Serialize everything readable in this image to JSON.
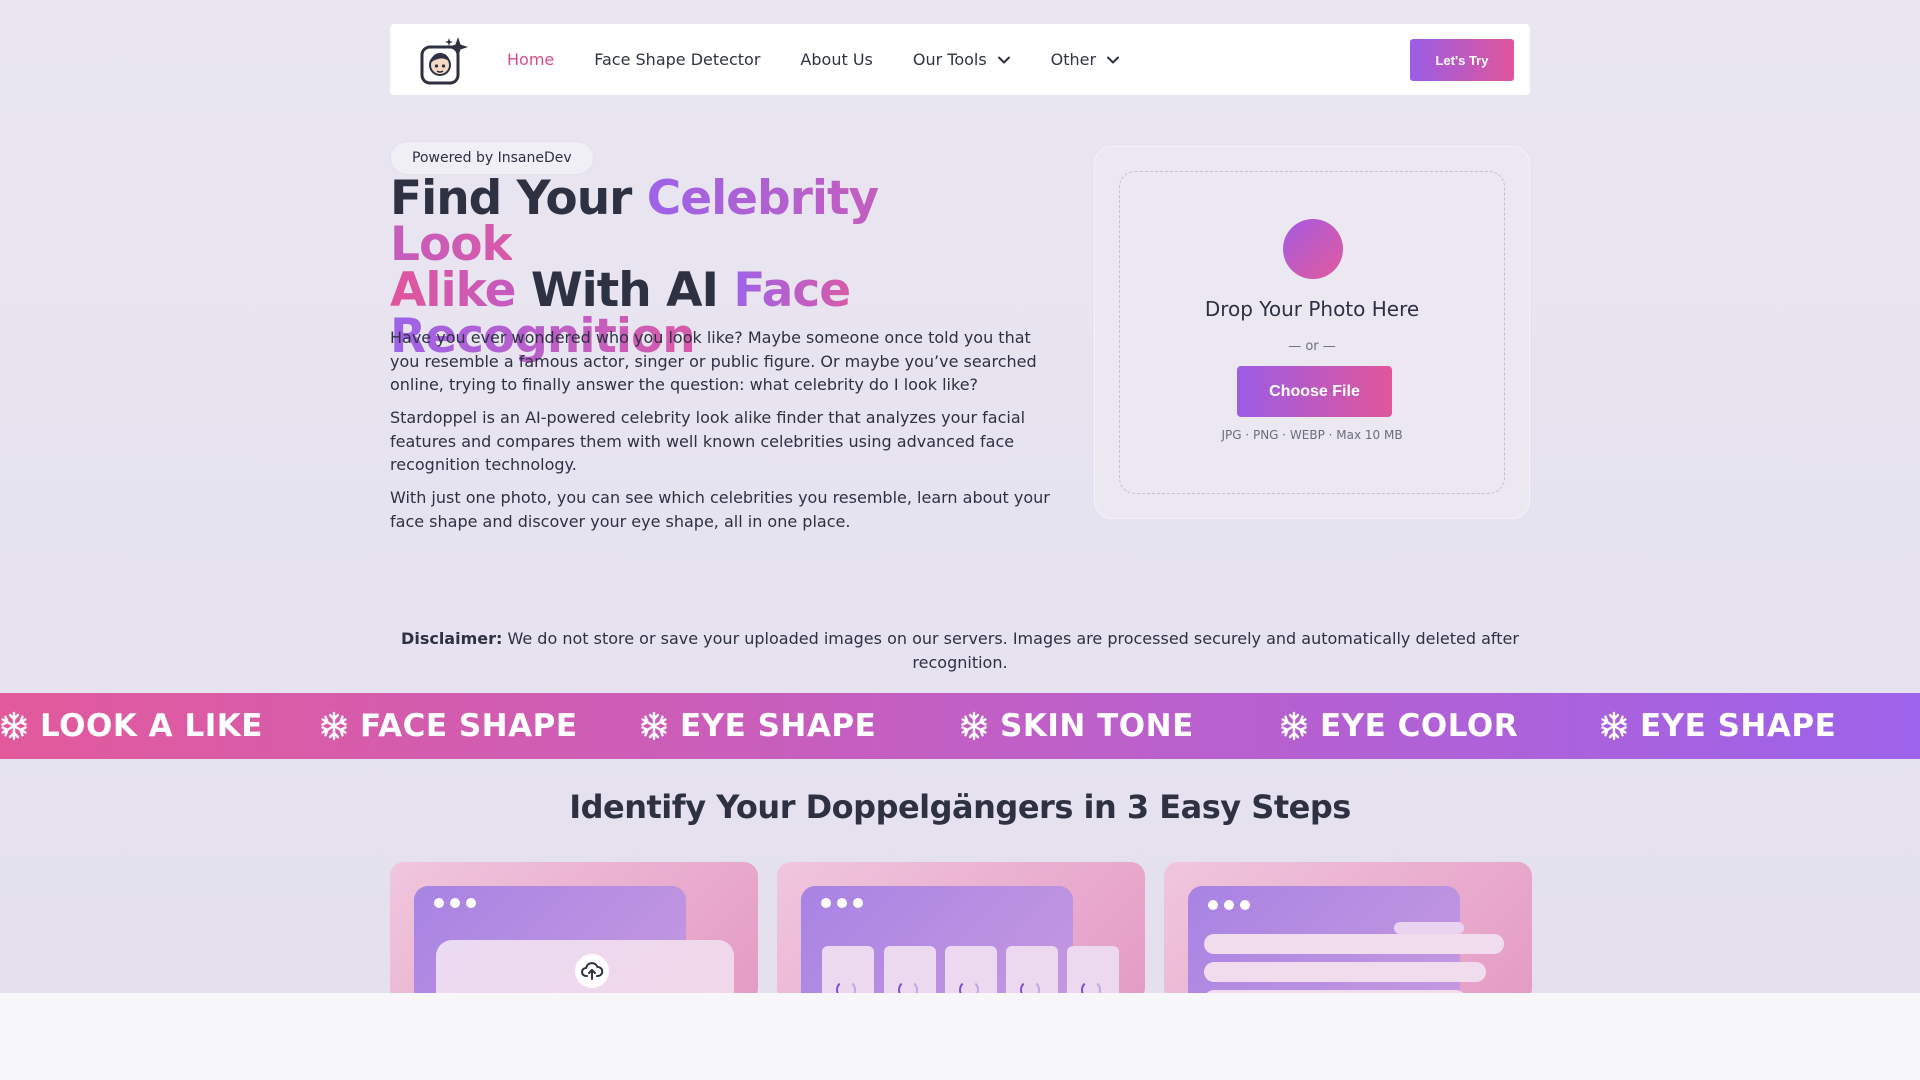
{
  "nav": {
    "links": [
      {
        "label": "Home",
        "active": true
      },
      {
        "label": "Face Shape Detector"
      },
      {
        "label": "About Us"
      },
      {
        "label": "Our Tools",
        "dropdown": true
      },
      {
        "label": "Other",
        "dropdown": true
      }
    ],
    "cta_label": "Let's Try"
  },
  "hero": {
    "badge": "Powered by InsaneDev",
    "title": {
      "part1": "Find Your ",
      "part2": "Celebrity Look",
      "part3": "Alike",
      "part4": " With AI ",
      "part5": "Face",
      "part6": "Recognition"
    },
    "paragraphs": [
      "Have you ever wondered who you look like? Maybe someone once told you that you resemble a famous actor, singer or public figure. Or maybe you’ve searched online, trying to finally answer the question: what celebrity do I look like?",
      "Stardoppel is an AI-powered celebrity look alike finder that analyzes your facial features and compares them with well known celebrities using advanced face recognition technology.",
      "With just one photo, you can see which celebrities you resemble, learn about your face shape and discover your eye shape, all in one place."
    ]
  },
  "upload": {
    "title": "Drop Your Photo Here",
    "or": "— or —",
    "button": "Choose File",
    "hint": "JPG · PNG · WEBP · Max 10 MB"
  },
  "disclaimer": {
    "label": "Disclaimer:",
    "text": " We do not store or save your uploaded images on our servers. Images are processed securely and automatically deleted after recognition."
  },
  "marquee": {
    "items": [
      "LOOK A LIKE",
      "FACE SHAPE",
      "EYE SHAPE",
      "SKIN TONE",
      "EYE COLOR",
      "EYE SHAPE"
    ]
  },
  "steps": {
    "title": "Identify Your Doppelgängers in 3 Easy Steps"
  },
  "colors": {
    "accent_purple": "#9b5de5",
    "accent_pink": "#e0569b",
    "active_link": "#d94c8a",
    "text_dark": "#2d3142"
  },
  "icons": {
    "logo": "face-sparkle-logo-icon",
    "dropdown": "chevron-down-icon",
    "marquee": "snowflake-icon",
    "upload": "cloud-upload-icon"
  }
}
